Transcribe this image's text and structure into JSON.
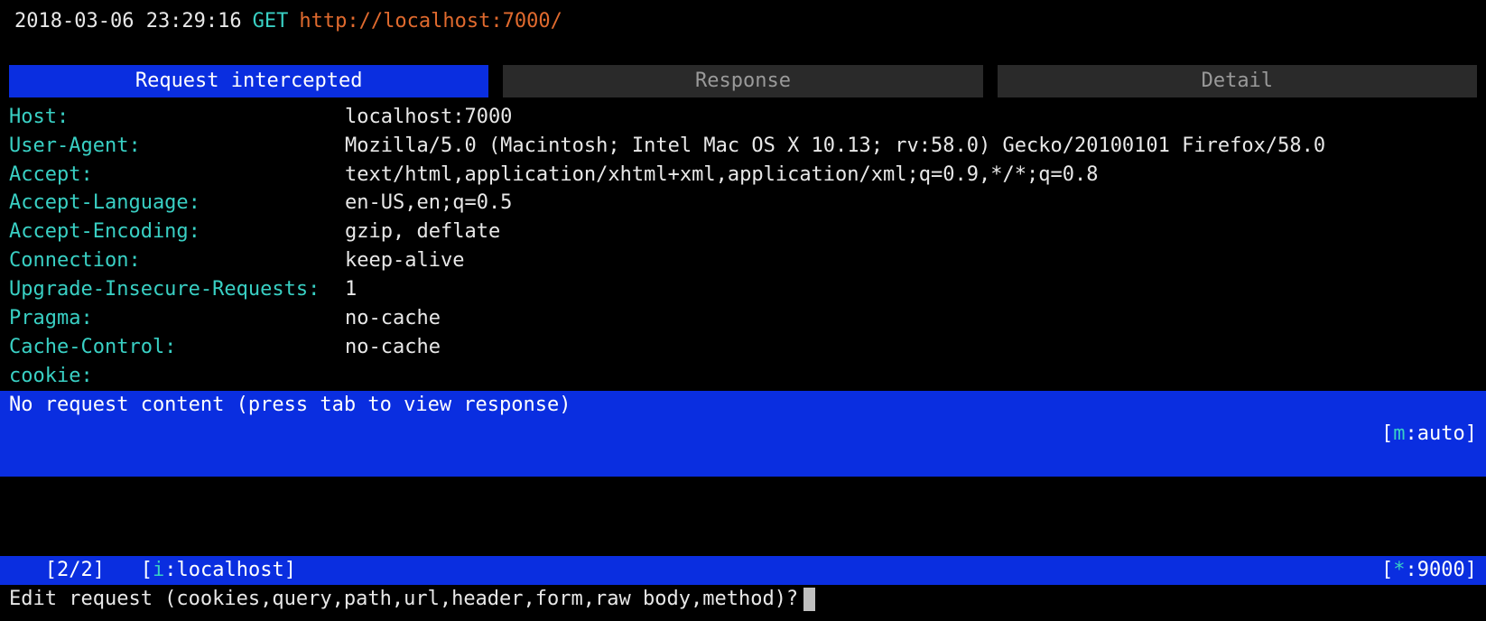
{
  "top": {
    "timestamp": "2018-03-06 23:29:16",
    "method": "GET",
    "url": "http://localhost:7000/"
  },
  "tabs": [
    {
      "label": "Request intercepted",
      "active": true
    },
    {
      "label": "Response",
      "active": false
    },
    {
      "label": "Detail",
      "active": false
    }
  ],
  "headers": [
    {
      "name": "Host:",
      "value": "localhost:7000"
    },
    {
      "name": "User-Agent:",
      "value": "Mozilla/5.0 (Macintosh; Intel Mac OS X 10.13; rv:58.0) Gecko/20100101 Firefox/58.0"
    },
    {
      "name": "Accept:",
      "value": "text/html,application/xhtml+xml,application/xml;q=0.9,*/*;q=0.8"
    },
    {
      "name": "Accept-Language:",
      "value": "en-US,en;q=0.5"
    },
    {
      "name": "Accept-Encoding:",
      "value": "gzip, deflate"
    },
    {
      "name": "Connection:",
      "value": "keep-alive"
    },
    {
      "name": "Upgrade-Insecure-Requests:",
      "value": "1"
    },
    {
      "name": "Pragma:",
      "value": "no-cache"
    },
    {
      "name": "Cache-Control:",
      "value": "no-cache"
    },
    {
      "name": "cookie:",
      "value": ""
    }
  ],
  "content_bar": {
    "message": "No request content (press tab to view response)",
    "mode_prefix": "[",
    "mode_key": "m",
    "mode_sep": ":",
    "mode_value": "auto",
    "mode_suffix": "]"
  },
  "status_bar": {
    "flow_pos": "[2/2]",
    "intercept_prefix": "[",
    "intercept_key": "i",
    "intercept_sep": ":",
    "intercept_value": "localhost",
    "intercept_suffix": "]",
    "port_prefix": "[",
    "port_key": "*",
    "port_sep": ":",
    "port_value": "9000",
    "port_suffix": "]"
  },
  "prompt": {
    "text": "Edit request (cookies,query,path,url,header,form,raw body,method)?"
  }
}
